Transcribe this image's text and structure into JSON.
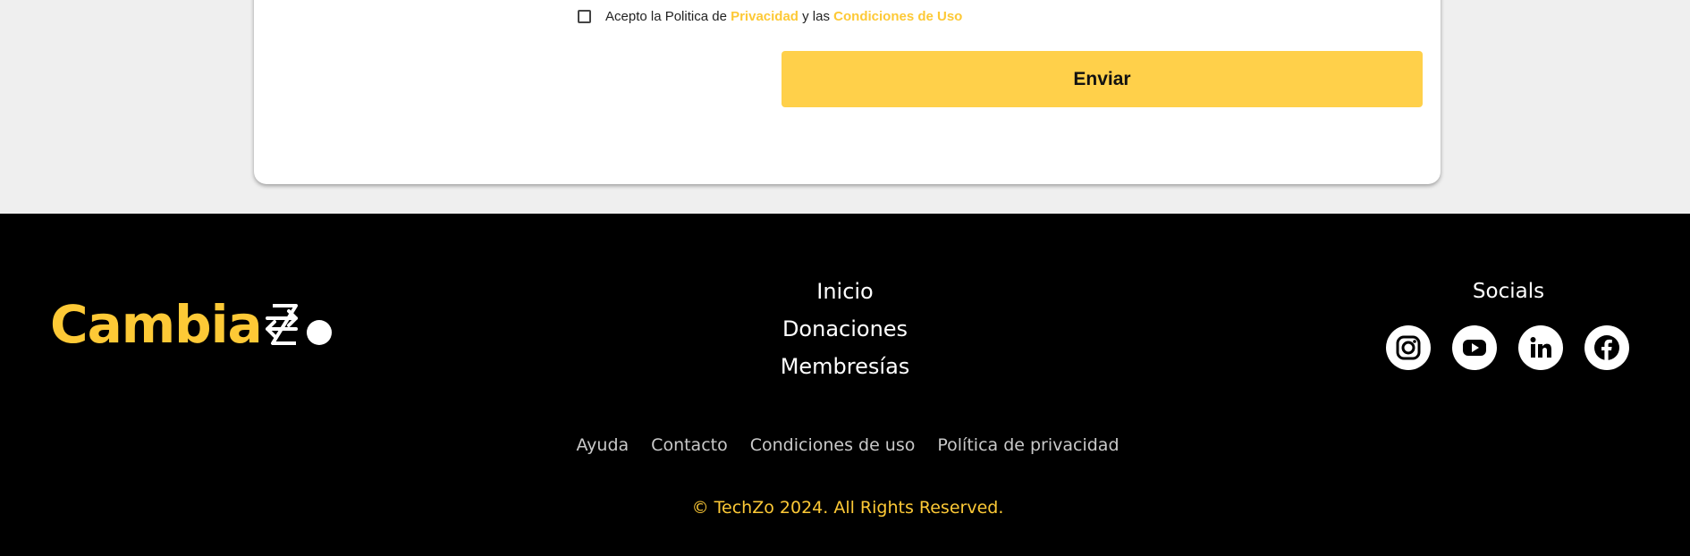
{
  "form": {
    "consent": {
      "prefix": "Acepto la Politica de",
      "privacy_link": "Privacidad",
      "middle": "y las",
      "terms_link": "Condiciones de Uso",
      "checked": false
    },
    "submit_label": "Enviar"
  },
  "footer": {
    "logo_text": "Cambia",
    "logo_alt": "CambiaZo",
    "main_nav": [
      {
        "label": "Inicio"
      },
      {
        "label": "Donaciones"
      },
      {
        "label": "Membresías"
      }
    ],
    "socials_title": "Socials",
    "socials": [
      {
        "icon": "instagram-icon"
      },
      {
        "icon": "youtube-icon"
      },
      {
        "icon": "linkedin-icon"
      },
      {
        "icon": "facebook-icon"
      }
    ],
    "bottom_links": [
      {
        "label": "Ayuda"
      },
      {
        "label": "Contacto"
      },
      {
        "label": "Condiciones de uso"
      },
      {
        "label": "Política de privacidad"
      }
    ],
    "copyright": "© TechZo 2024. All Rights Reserved."
  },
  "colors": {
    "accent": "#fdc936",
    "button": "#ffd04a",
    "footer_bg": "#000000",
    "page_bg": "#efefef"
  }
}
